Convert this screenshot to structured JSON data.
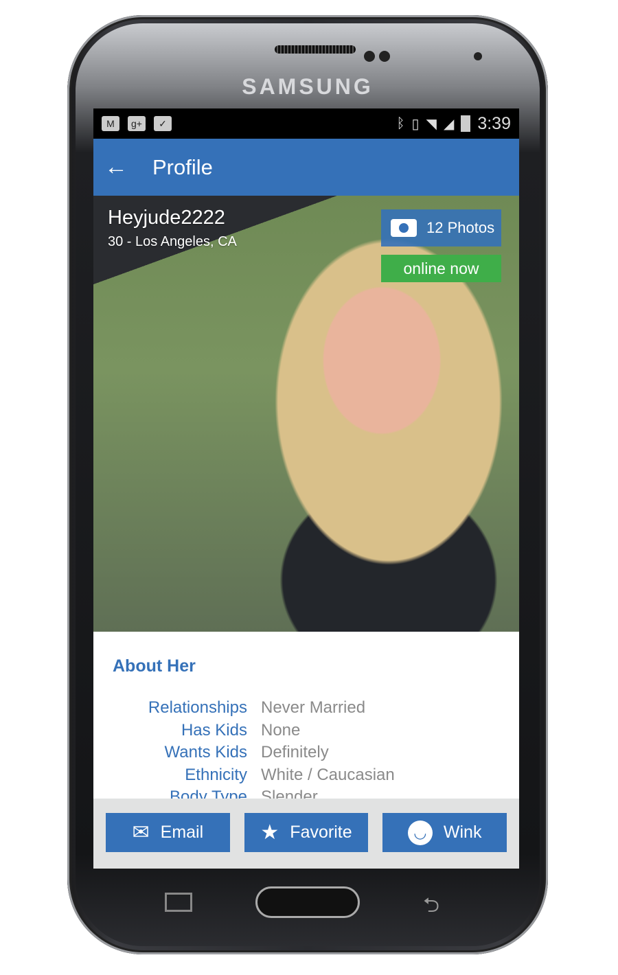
{
  "device": {
    "brand": "SAMSUNG"
  },
  "status_bar": {
    "left_icons": [
      "gmail-icon",
      "google-plus-icon",
      "shopping-bag-icon"
    ],
    "right_icons": [
      "bluetooth-icon",
      "vibrate-icon",
      "wifi-icon",
      "signal-icon",
      "battery-icon"
    ],
    "time": "3:39"
  },
  "app_bar": {
    "title": "Profile",
    "back_icon": "arrow-left-icon"
  },
  "profile": {
    "username": "Heyjude2222",
    "location": "30 - Los Angeles, CA",
    "photos_label": "12 Photos",
    "online_label": "online now",
    "online_color": "#3fae49"
  },
  "about": {
    "heading": "About Her",
    "rows": [
      {
        "key": "Relationships",
        "value": "Never Married"
      },
      {
        "key": "Has Kids",
        "value": "None"
      },
      {
        "key": "Wants Kids",
        "value": "Definitely"
      },
      {
        "key": "Ethnicity",
        "value": "White / Caucasian"
      },
      {
        "key": "Body Type",
        "value": "Slender"
      }
    ]
  },
  "actions": {
    "email": "Email",
    "favorite": "Favorite",
    "wink": "Wink"
  },
  "colors": {
    "accent": "#3571b8"
  }
}
